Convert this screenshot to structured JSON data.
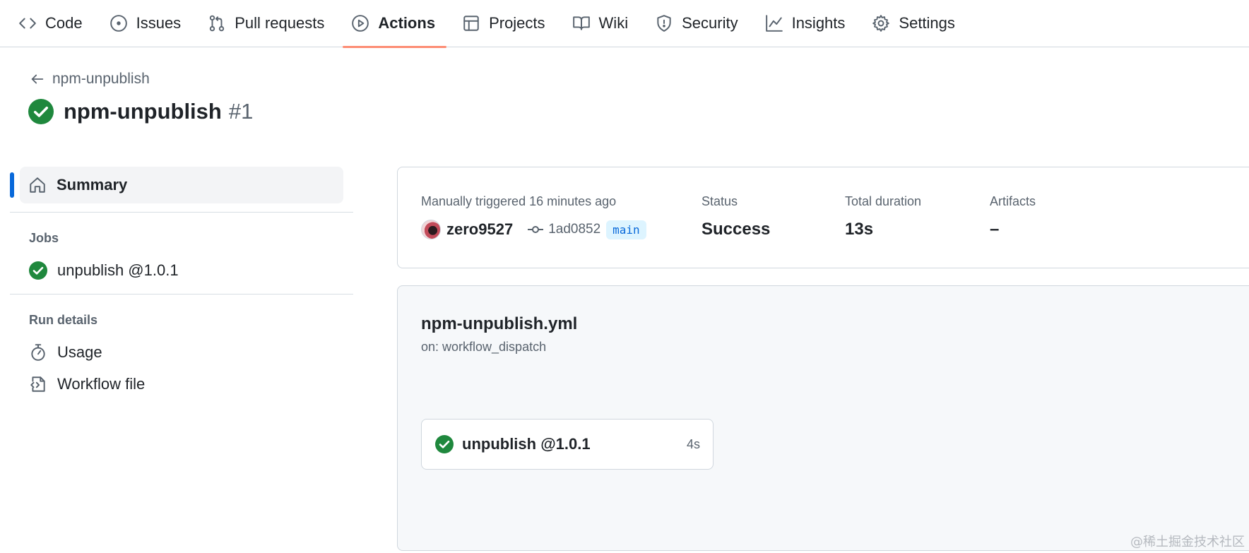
{
  "nav": {
    "tabs": [
      {
        "label": "Code",
        "icon": "code-icon"
      },
      {
        "label": "Issues",
        "icon": "issue-icon"
      },
      {
        "label": "Pull requests",
        "icon": "pull-request-icon"
      },
      {
        "label": "Actions",
        "icon": "play-icon",
        "active": true
      },
      {
        "label": "Projects",
        "icon": "table-icon"
      },
      {
        "label": "Wiki",
        "icon": "book-icon"
      },
      {
        "label": "Security",
        "icon": "shield-icon"
      },
      {
        "label": "Insights",
        "icon": "graph-icon"
      },
      {
        "label": "Settings",
        "icon": "gear-icon"
      }
    ],
    "active_underline_color": "#fd8c73"
  },
  "header": {
    "back_label": "npm-unpublish",
    "title": "npm-unpublish",
    "run_number": "#1",
    "status_icon": "check-circle-icon",
    "success_color": "#1f883d"
  },
  "sidebar": {
    "summary_label": "Summary",
    "jobs_heading": "Jobs",
    "jobs": [
      {
        "label": "unpublish @1.0.1",
        "status": "success"
      }
    ],
    "run_details_heading": "Run details",
    "run_details": [
      {
        "label": "Usage",
        "icon": "stopwatch-icon"
      },
      {
        "label": "Workflow file",
        "icon": "file-code-icon"
      }
    ],
    "accent_color": "#0969da"
  },
  "summary": {
    "trigger_label": "Manually triggered 16 minutes ago",
    "username": "zero9527",
    "commit": "1ad0852",
    "branch": "main",
    "status_label": "Status",
    "status_value": "Success",
    "duration_label": "Total duration",
    "duration_value": "13s",
    "artifacts_label": "Artifacts",
    "artifacts_value": "–"
  },
  "workflow": {
    "file": "npm-unpublish.yml",
    "trigger": "on: workflow_dispatch",
    "job": {
      "name": "unpublish @1.0.1",
      "duration": "4s"
    }
  },
  "watermark": "@稀土掘金技术社区"
}
